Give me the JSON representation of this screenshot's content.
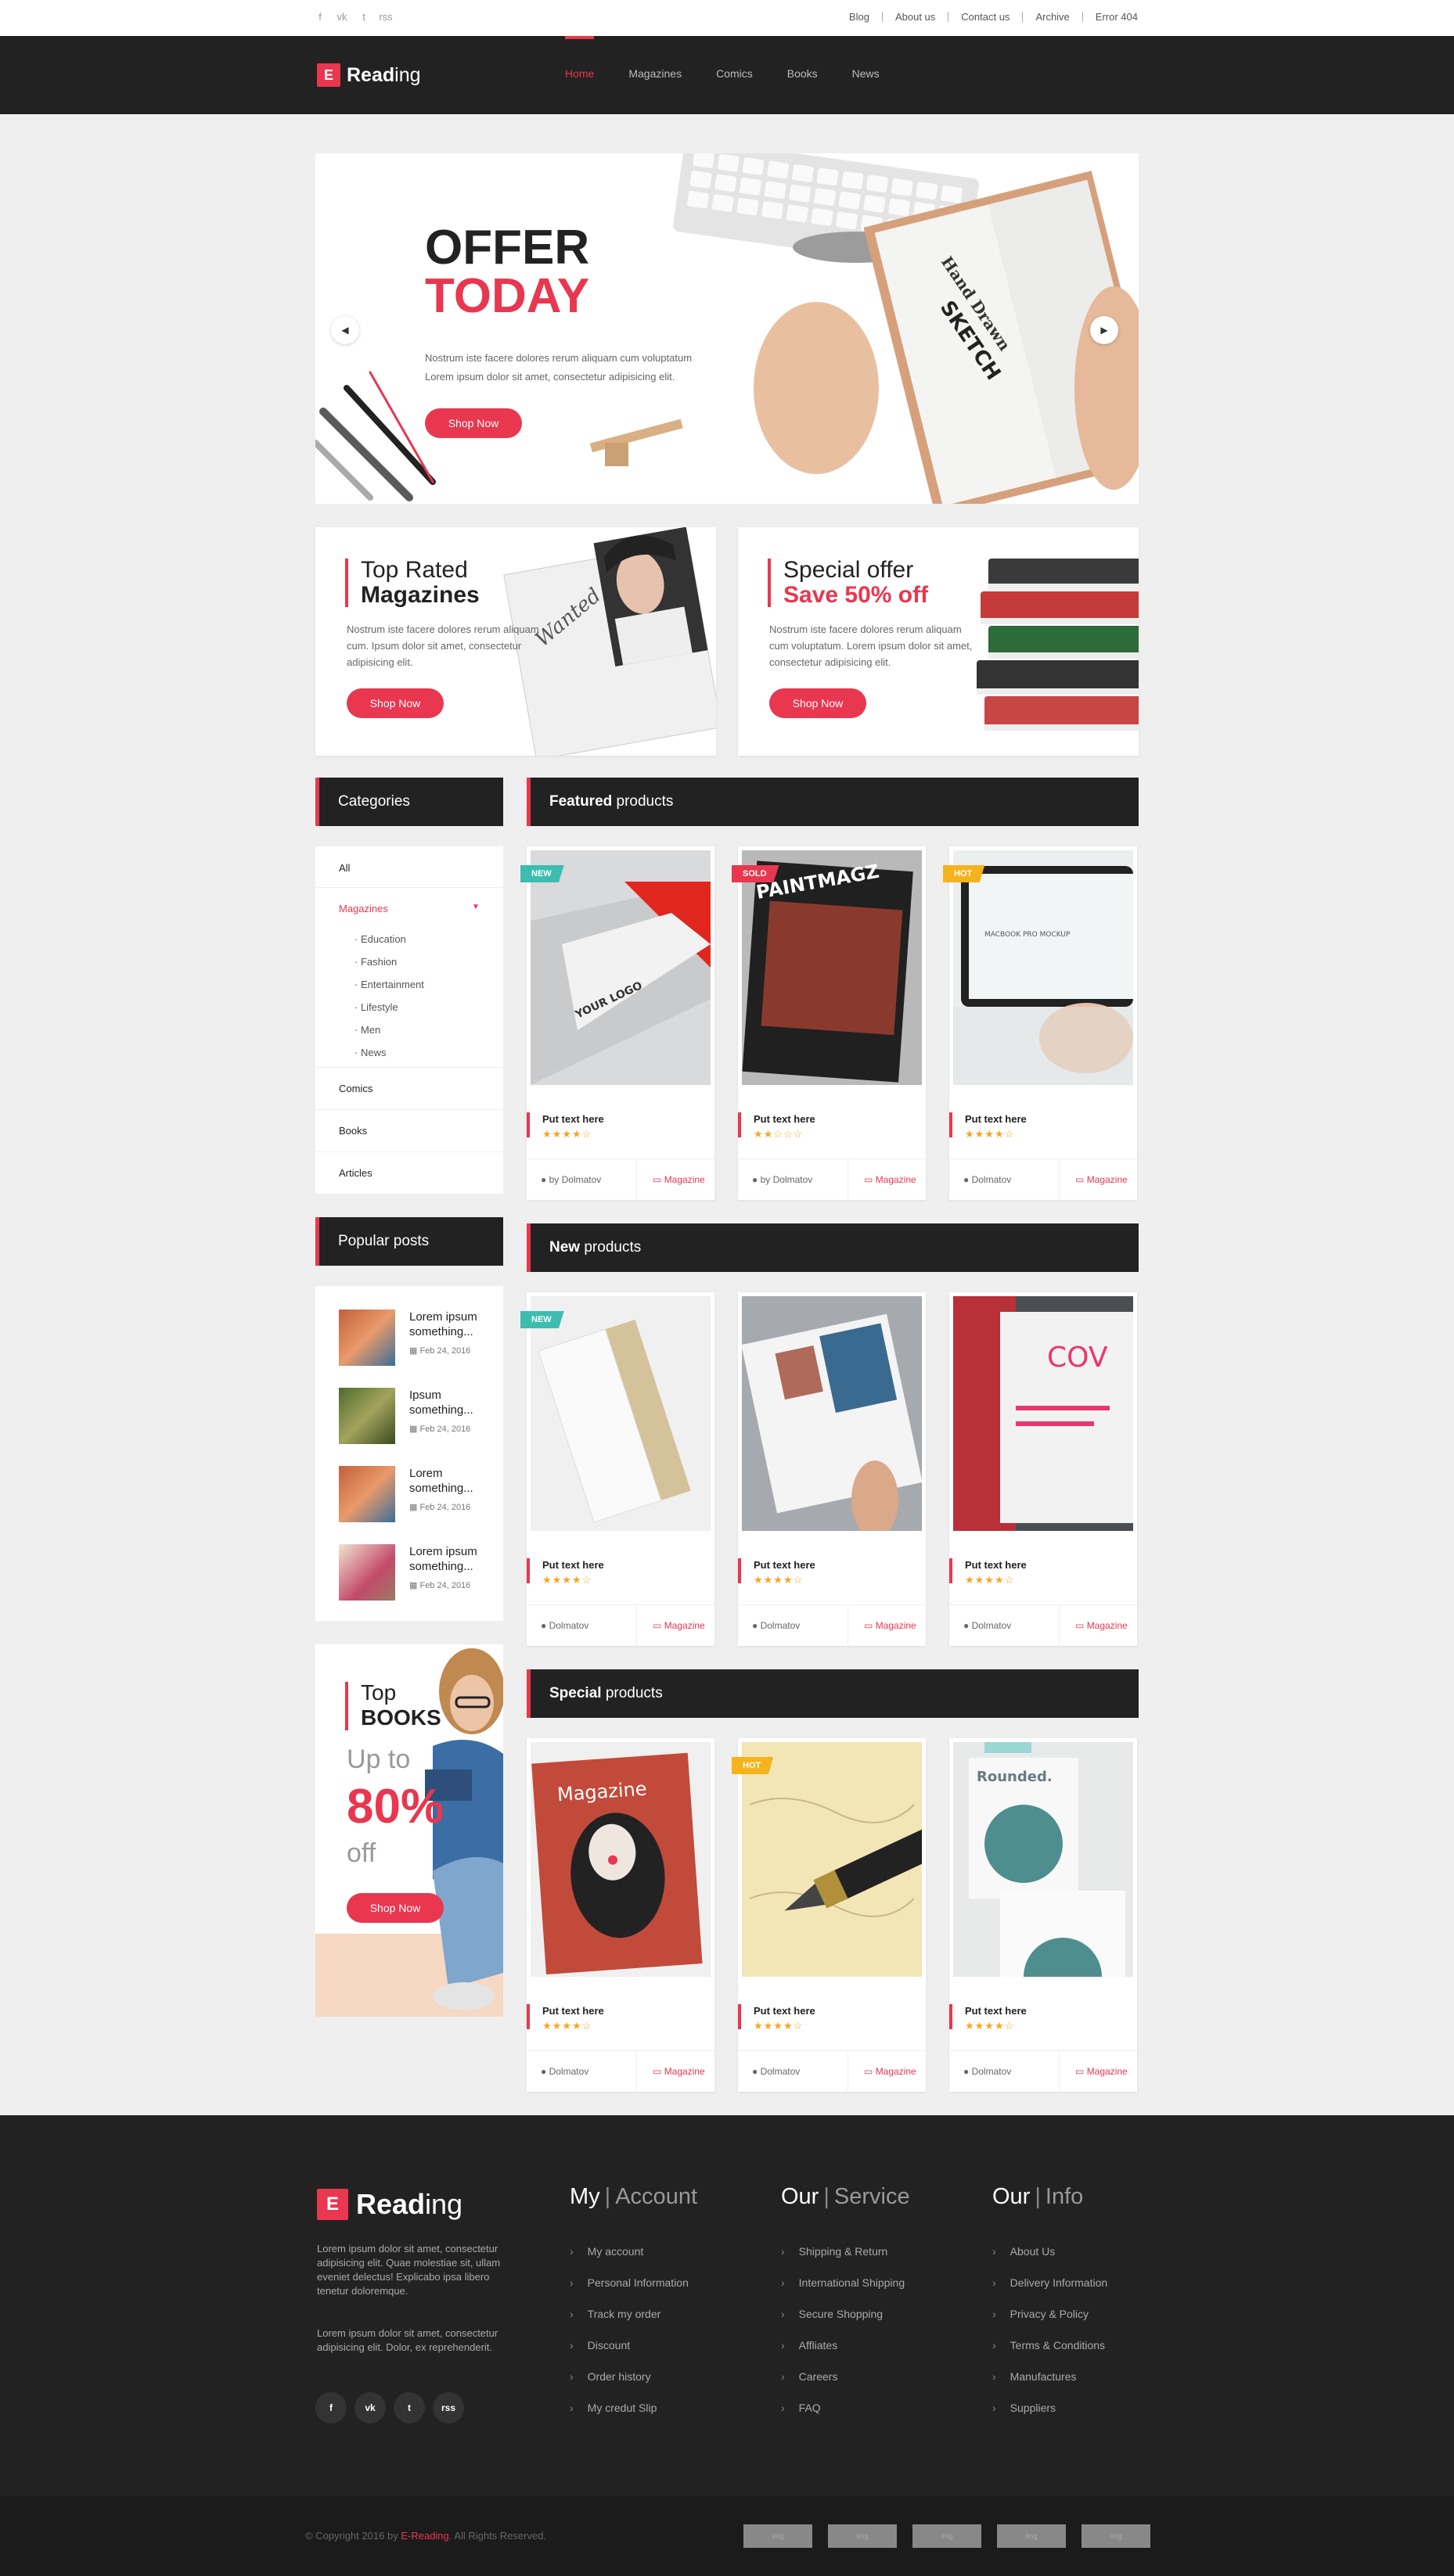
{
  "topbar": {
    "social": [
      "f",
      "vk",
      "t",
      "rss"
    ],
    "links": [
      "Blog",
      "About us",
      "Contact us",
      "Archive",
      "Error 404"
    ]
  },
  "header": {
    "logo_mark": "E",
    "logo_pre": "Read",
    "logo_post": "ing",
    "nav": [
      "Home",
      "Magazines",
      "Comics",
      "Books",
      "News"
    ]
  },
  "hero": {
    "title1": "OFFER",
    "title2": "TODAY",
    "text": "Nostrum iste facere dolores rerum aliquam cum voluptatum Lorem ipsum dolor sit amet, consectetur adipisicing elit.",
    "button": "Shop Now",
    "sketch_text": "Hand Drawn SKETCH MOCK UP"
  },
  "promo1": {
    "line1": "Top Rated",
    "line2": "Magazines",
    "text": "Nostrum iste facere dolores rerum aliquam cum. Ipsum dolor sit amet, consectetur adipisicing elit.",
    "button": "Shop Now"
  },
  "promo2": {
    "line1": "Special offer",
    "line2": "Save 50% off",
    "text": "Nostrum iste facere dolores rerum aliquam cum voluptatum. Lorem ipsum dolor sit amet, consectetur adipisicing elit.",
    "button": "Shop Now"
  },
  "categories": {
    "title": "Categories",
    "all": "All",
    "magazines": "Magazines",
    "sub": [
      "Education",
      "Fashion",
      "Entertainment",
      "Lifestyle",
      "Men",
      "News"
    ],
    "others": [
      "Comics",
      "Books",
      "Articles"
    ]
  },
  "popular": {
    "title": "Popular posts",
    "posts": [
      {
        "title": "Lorem ipsum something...",
        "date": "Feb 24, 2016"
      },
      {
        "title": "Ipsum something...",
        "date": "Feb 24, 2016"
      },
      {
        "title": "Lorem something...",
        "date": "Feb 24, 2016"
      },
      {
        "title": "Lorem ipsum something...",
        "date": "Feb 24, 2016"
      }
    ]
  },
  "topbooks": {
    "line1": "Top",
    "line2": "BOOKS",
    "upto": "Up to",
    "percent": "80%",
    "off": "off",
    "button": "Shop Now"
  },
  "featured": {
    "title_bold": "Featured",
    "title_rest": "products",
    "items": [
      {
        "badge": "NEW",
        "title": "Put text here",
        "stars": "★★★★☆",
        "author": "by Dolmatov",
        "category": "Magazine",
        "cover": "YOUR LOGO"
      },
      {
        "badge": "SOLD",
        "title": "Put text here",
        "stars": "★★☆☆☆",
        "author": "by Dolmatov",
        "category": "Magazine",
        "cover": "PAINTMAGZ"
      },
      {
        "badge": "HOT",
        "title": "Put text here",
        "stars": "★★★★☆",
        "author": "Dolmatov",
        "category": "Magazine",
        "cover": "MACBOOK PRO MOCKUP"
      }
    ]
  },
  "newp": {
    "title_bold": "New",
    "title_rest": "products",
    "items": [
      {
        "badge": "NEW",
        "title": "Put text here",
        "stars": "★★★★☆",
        "author": "Dolmatov",
        "category": "Magazine"
      },
      {
        "badge": "",
        "title": "Put text here",
        "stars": "★★★★☆",
        "author": "Dolmatov",
        "category": "Magazine"
      },
      {
        "badge": "",
        "title": "Put text here",
        "stars": "★★★★☆",
        "author": "Dolmatov",
        "category": "Magazine",
        "cover": "COV"
      }
    ]
  },
  "special": {
    "title_bold": "Special",
    "title_rest": "products",
    "items": [
      {
        "badge": "",
        "title": "Put text here",
        "stars": "★★★★☆",
        "author": "Dolmatov",
        "category": "Magazine",
        "cover": "Magazine"
      },
      {
        "badge": "HOT",
        "title": "Put text here",
        "stars": "★★★★☆",
        "author": "Dolmatov",
        "category": "Magazine"
      },
      {
        "badge": "",
        "title": "Put text here",
        "stars": "★★★★☆",
        "author": "Dolmatov",
        "category": "Magazine",
        "cover": "Rounded."
      }
    ]
  },
  "footer": {
    "about1": "Lorem ipsum dolor sit amet, consectetur adipisicing elit. Quae molestiae sit, ullam eveniet delectus! Explicabo ipsa libero tenetur doloremque.",
    "about2": "Lorem ipsum dolor sit amet, consectetur adipisicing elit. Dolor, ex reprehenderit.",
    "social": [
      "f",
      "vk",
      "t",
      "rss"
    ],
    "col1": {
      "a": "My",
      "b": "Account",
      "items": [
        "My account",
        "Personal Information",
        "Track my order",
        "Discount",
        "Order history",
        "My credut Slip"
      ]
    },
    "col2": {
      "a": "Our",
      "b": "Service",
      "items": [
        "Shipping & Return",
        "International Shipping",
        "Secure Shopping",
        "Affliates",
        "Careers",
        "FAQ"
      ]
    },
    "col3": {
      "a": "Our",
      "b": "Info",
      "items": [
        "About Us",
        "Delivery Information",
        "Privacy & Policy",
        "Terms & Conditions",
        "Manufactures",
        "Suppliers"
      ]
    }
  },
  "copyright": {
    "pre": "© Copyright 2016 by ",
    "brand": "E-Reading",
    "post": ". All Rights Reserved.",
    "payments": [
      "Img",
      "Img",
      "Img",
      "Img",
      "Img"
    ]
  },
  "colors": {
    "accent": "#e8374f",
    "dark": "#222222",
    "new": "#3dbdb0",
    "hot": "#f5b31c"
  }
}
